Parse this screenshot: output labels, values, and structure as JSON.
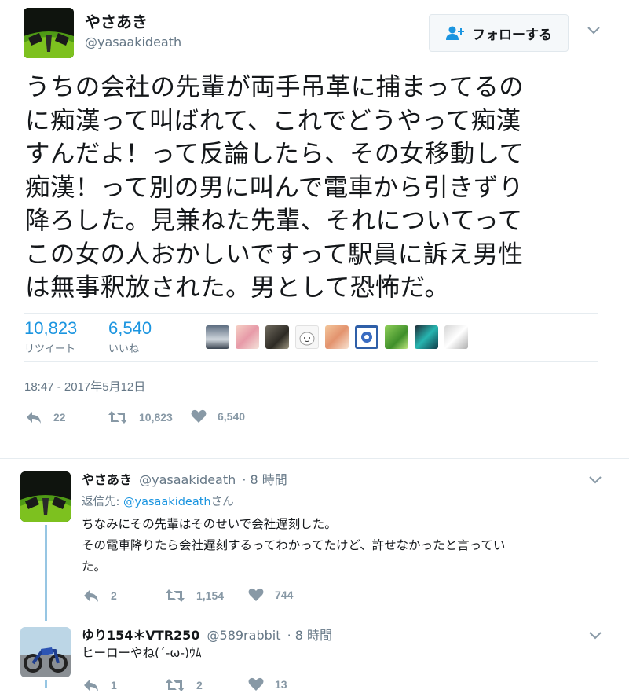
{
  "main_tweet": {
    "display_name": "やさあき",
    "handle": "@yasaakideath",
    "follow_label": "フォローする",
    "text_lines": [
      "うちの会社の先輩が両手吊革に捕まってるの",
      "に痴漢って叫ばれて、これでどうやって痴漢",
      "すんだよ！って反論したら、その女移動して",
      "痴漢！って別の男に叫んで電車から引きずり",
      "降ろした。見兼ねた先輩、それについてって",
      "この女の人おかしいですって駅員に訴え男性",
      "は無事釈放された。男として恐怖だ。"
    ],
    "retweet_count": "10,823",
    "retweet_label": "リツイート",
    "like_count": "6,540",
    "like_label": "いいね",
    "timestamp": "18:47 - 2017年5月12日",
    "actions": {
      "reply": "22",
      "retweet": "10,823",
      "like": "6,540"
    }
  },
  "replies": [
    {
      "display_name": "やさあき",
      "handle": "@yasaakideath",
      "time": "· 8 時間",
      "reply_prefix": "返信先: ",
      "reply_to": "@yasaakideath",
      "reply_suffix": "さん",
      "lines": [
        "ちなみにその先輩はそのせいで会社遅刻した。",
        "その電車降りたら会社遅刻するってわかってたけど、許せなかったと言ってい",
        "た。"
      ],
      "actions": {
        "reply": "2",
        "retweet": "1,154",
        "like": "744"
      }
    },
    {
      "display_name": "ゆり154＊VTR250",
      "handle": "@589rabbit",
      "time": "· 8 時間",
      "lines": [
        "ヒーローやね(´-ω-)ｳﾑ"
      ],
      "actions": {
        "reply": "1",
        "retweet": "2",
        "like": "13"
      }
    }
  ],
  "colors": {
    "accent": "#1b95e0",
    "text": "#14171a",
    "muted": "#657786",
    "icon": "#8899a6",
    "thread_line": "#97c6e3"
  }
}
